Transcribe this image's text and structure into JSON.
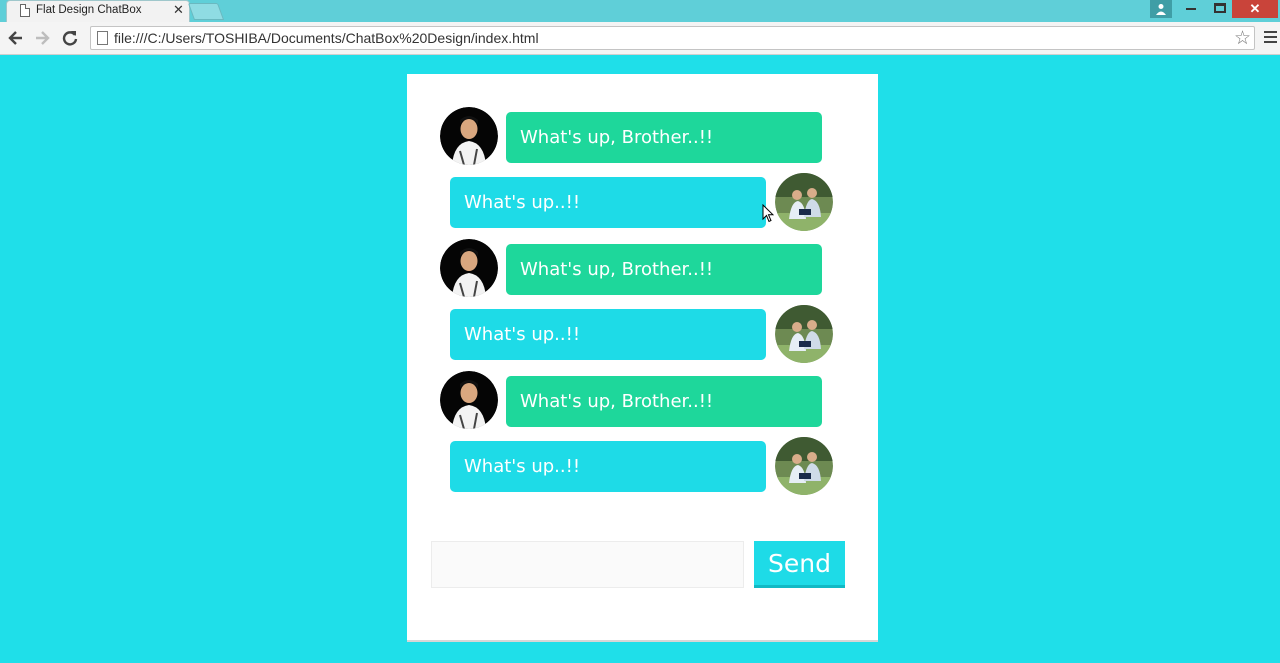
{
  "browser": {
    "tab_title": "Flat Design ChatBox",
    "tab_close": "✕",
    "url": "file:///C:/Users/TOSHIBA/Documents/ChatBox%20Design/index.html",
    "window_close": "✕",
    "icons": [
      "page-icon",
      "back-icon",
      "forward-icon",
      "reload-icon",
      "star-icon",
      "menu-icon",
      "user-icon",
      "minimize-icon",
      "maximize-icon",
      "close-icon"
    ]
  },
  "chat": {
    "messages": [
      {
        "side": "left",
        "text": "What's up, Brother..!!",
        "color": "#1ed79b"
      },
      {
        "side": "right",
        "text": "What's up..!!",
        "color": "#1edbe7"
      },
      {
        "side": "left",
        "text": "What's up, Brother..!!",
        "color": "#1ed79b"
      },
      {
        "side": "right",
        "text": "What's up..!!",
        "color": "#1edbe7"
      },
      {
        "side": "left",
        "text": "What's up, Brother..!!",
        "color": "#1ed79b"
      },
      {
        "side": "right",
        "text": "What's up..!!",
        "color": "#1edbe7"
      }
    ],
    "input_value": "",
    "input_placeholder": "",
    "send_label": "Send"
  },
  "colors": {
    "page_background": "#1fdfe9",
    "card_background": "#ffffff",
    "left_bubble": "#1ed79b",
    "right_bubble": "#1edbe7"
  }
}
